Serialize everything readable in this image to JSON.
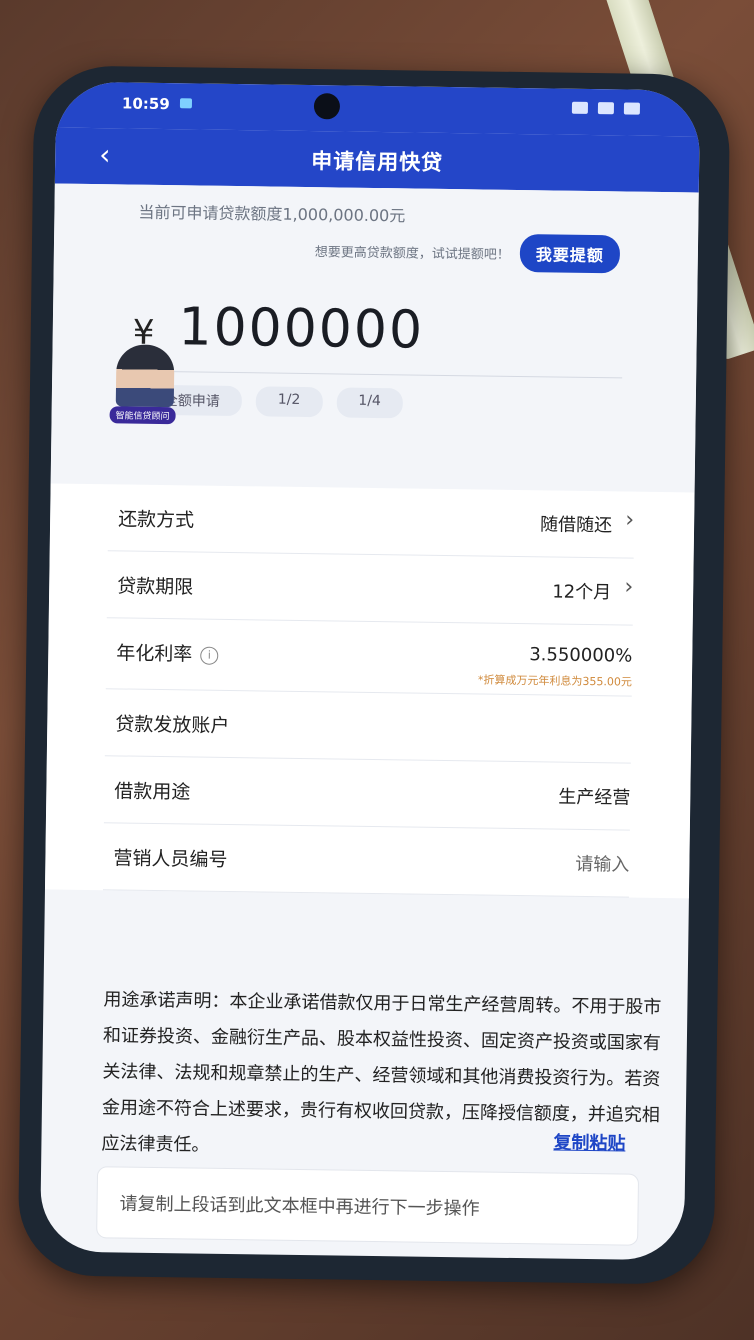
{
  "status_bar": {
    "time": "10:59"
  },
  "nav": {
    "title": "申请信用快贷"
  },
  "amount_card": {
    "limit_text": "当前可申请贷款额度1,000,000.00元",
    "hint_text": "想要更高贷款额度，试试提额吧！",
    "raise_button": "我要提额",
    "currency_symbol": "¥",
    "amount": "1000000",
    "chips": [
      "全额申请",
      "1/2",
      "1/4"
    ],
    "avatar_badge": "智能信贷顾问"
  },
  "form": {
    "repayment": {
      "label": "还款方式",
      "value": "随借随还"
    },
    "term": {
      "label": "贷款期限",
      "value": "12个月"
    },
    "rate": {
      "label": "年化利率",
      "value": "3.550000%",
      "note": "*折算成万元年利息为355.00元"
    },
    "account": {
      "label": "贷款发放账户"
    },
    "purpose": {
      "label": "借款用途",
      "value": "生产经营"
    },
    "marketer": {
      "label": "营销人员编号",
      "placeholder": "请输入"
    }
  },
  "statement": {
    "text": "用途承诺声明：本企业承诺借款仅用于日常生产经营周转。不用于股市和证券投资、金融衍生产品、股本权益性投资、固定资产投资或国家有关法律、法规和规章禁止的生产、经营领域和其他消费投资行为。若资金用途不符合上述要求，贵行有权收回贷款，压降授信额度，并追究相应法律责任。",
    "copy_link": "复制粘贴",
    "input_placeholder": "请复制上段话到此文本框中再进行下一步操作"
  },
  "system_nav": {
    "menu": "☰",
    "home": "□",
    "back": "◁"
  },
  "colors": {
    "brand_blue": "#2446c8",
    "link_blue": "#1e46c6",
    "note_orange": "#d08a3c"
  }
}
